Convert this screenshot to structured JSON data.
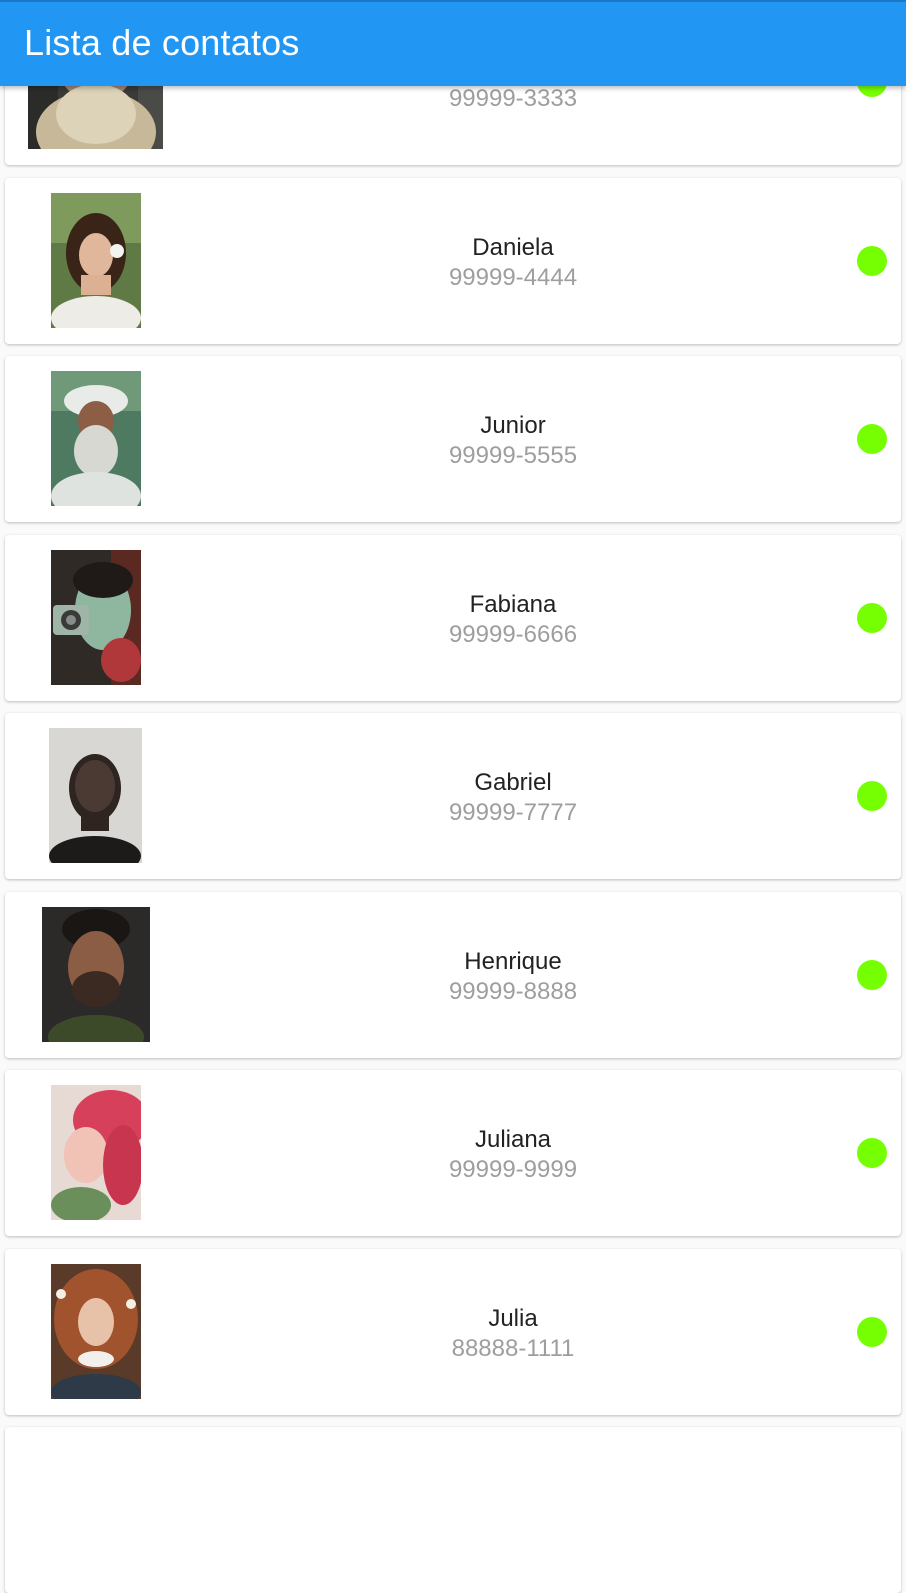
{
  "appbar": {
    "title": "Lista de contatos"
  },
  "colors": {
    "appbar": "#2196f3",
    "status_online": "#76ff03",
    "name_text": "#222222",
    "phone_text": "#9e9e9e"
  },
  "contacts": [
    {
      "name": "",
      "phone": "99999-3333",
      "status": "online",
      "photo": "bearded-man-photo"
    },
    {
      "name": "Daniela",
      "phone": "99999-4444",
      "status": "online",
      "photo": "woman-flower-photo"
    },
    {
      "name": "Junior",
      "phone": "99999-5555",
      "status": "online",
      "photo": "old-man-turban-photo"
    },
    {
      "name": "Fabiana",
      "phone": "99999-6666",
      "status": "online",
      "photo": "woman-camera-photo"
    },
    {
      "name": "Gabriel",
      "phone": "99999-7777",
      "status": "online",
      "photo": "man-portrait-photo"
    },
    {
      "name": "Henrique",
      "phone": "99999-8888",
      "status": "online",
      "photo": "bearded-young-man-photo"
    },
    {
      "name": "Juliana",
      "phone": "99999-9999",
      "status": "online",
      "photo": "red-hair-woman-photo"
    },
    {
      "name": "Julia",
      "phone": "88888-1111",
      "status": "online",
      "photo": "curly-hair-woman-photo"
    }
  ]
}
